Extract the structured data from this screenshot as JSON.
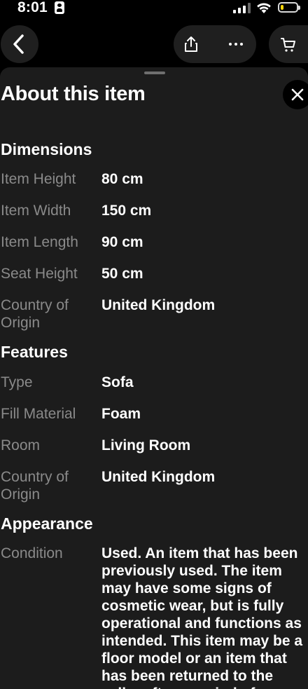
{
  "status_bar": {
    "time": "8:01",
    "battery_level": 0.18
  },
  "nav": {
    "back_icon": "chevron-left-icon",
    "share_icon": "share-icon",
    "more_icon": "more-horizontal-icon",
    "cart_icon": "cart-icon"
  },
  "sheet": {
    "title": "About this item",
    "close_icon": "close-icon"
  },
  "sections": {
    "dimensions": {
      "title": "Dimensions",
      "rows": [
        {
          "label": "Item Height",
          "value": "80 cm"
        },
        {
          "label": "Item Width",
          "value": "150 cm"
        },
        {
          "label": "Item Length",
          "value": "90 cm"
        },
        {
          "label": "Seat Height",
          "value": "50 cm"
        },
        {
          "label": "Country of Origin",
          "value": "United Kingdom"
        }
      ]
    },
    "features": {
      "title": "Features",
      "rows": [
        {
          "label": "Type",
          "value": "Sofa"
        },
        {
          "label": "Fill Material",
          "value": "Foam"
        },
        {
          "label": "Room",
          "value": "Living Room"
        },
        {
          "label": "Country of Origin",
          "value": "United Kingdom"
        }
      ]
    },
    "appearance": {
      "title": "Appearance",
      "rows": [
        {
          "label": "Condition",
          "value": "Used. An item that has been previously used. The item may have some signs of cosmetic wear, but is fully operational and functions as intended. This item may be a floor model or an item that has been returned to the seller after a period of use."
        }
      ]
    }
  },
  "colors": {
    "sheet_bg": "#1c1c1c",
    "label_gray": "#8a8a8a",
    "battery_yellow": "#ffd60a"
  }
}
